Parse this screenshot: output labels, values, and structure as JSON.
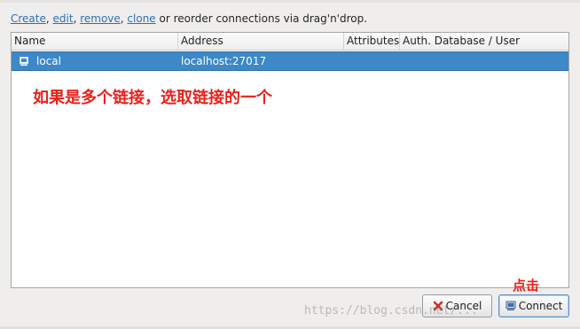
{
  "instructions": {
    "create": "Create",
    "sep1": ", ",
    "edit": "edit",
    "sep2": ", ",
    "remove": "remove",
    "sep3": ", ",
    "clone": "clone",
    "rest": " or reorder connections via drag'n'drop."
  },
  "table": {
    "columns": [
      "Name",
      "Address",
      "Attributes",
      "Auth. Database / User"
    ],
    "rows": [
      {
        "icon": "connection-icon",
        "name": "local",
        "address": "localhost:27017",
        "attributes": "",
        "auth": "",
        "selected": true
      }
    ]
  },
  "annotations": {
    "select_hint": "如果是多个链接，选取链接的一个",
    "click_hint": "点击",
    "color": "#e8221b"
  },
  "buttons": {
    "cancel": "Cancel",
    "cancel_icon": "cancel-icon",
    "connect": "Connect",
    "connect_icon": "connect-icon"
  },
  "watermark": "https://blog.csdn.net/..."
}
